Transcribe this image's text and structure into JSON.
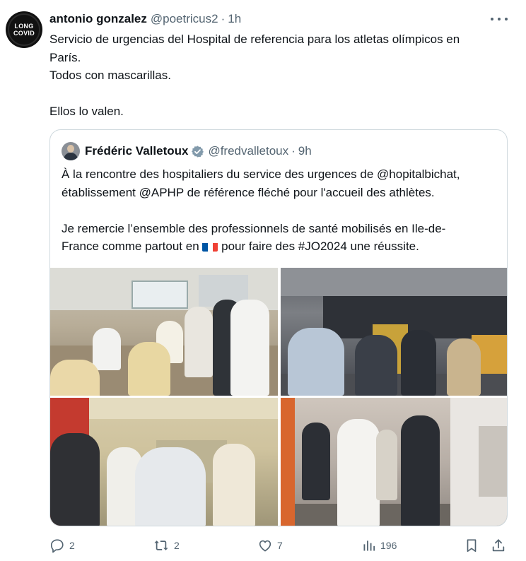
{
  "tweet": {
    "author_name": "antonio gonzalez",
    "author_handle": "@poetricus2",
    "separator": "·",
    "time": "1h",
    "avatar_text_top": "LONG",
    "avatar_text_bottom": "COVID",
    "text_lines": [
      "Servicio de urgencias del Hospital de referencia para los atletas olímpicos en",
      "París.",
      "Todos con mascarillas.",
      "",
      "Ellos lo valen."
    ]
  },
  "quote": {
    "author_name": "Frédéric Valletoux",
    "author_handle": "@fredvalletoux",
    "separator": "·",
    "time": "9h",
    "text_lines": [
      "À la rencontre des hospitaliers du service des urgences de @hopitalbichat,",
      "établissement @APHP de référence fléché pour l'accueil des athlètes.",
      "",
      "Je remercie l’ensemble des professionnels de santé mobilisés en Ile-de-",
      "France comme partout en",
      "pour faire des #JO2024 une réussite."
    ],
    "flag_colors": [
      "#0055A4",
      "#FFFFFF",
      "#EF4135"
    ],
    "verified_color": "#829aab"
  },
  "actions": {
    "replies": "2",
    "retweets": "2",
    "likes": "7",
    "views": "196"
  },
  "colors": {
    "text": "#0f1419",
    "secondary": "#536471",
    "border": "#cfd9de"
  }
}
